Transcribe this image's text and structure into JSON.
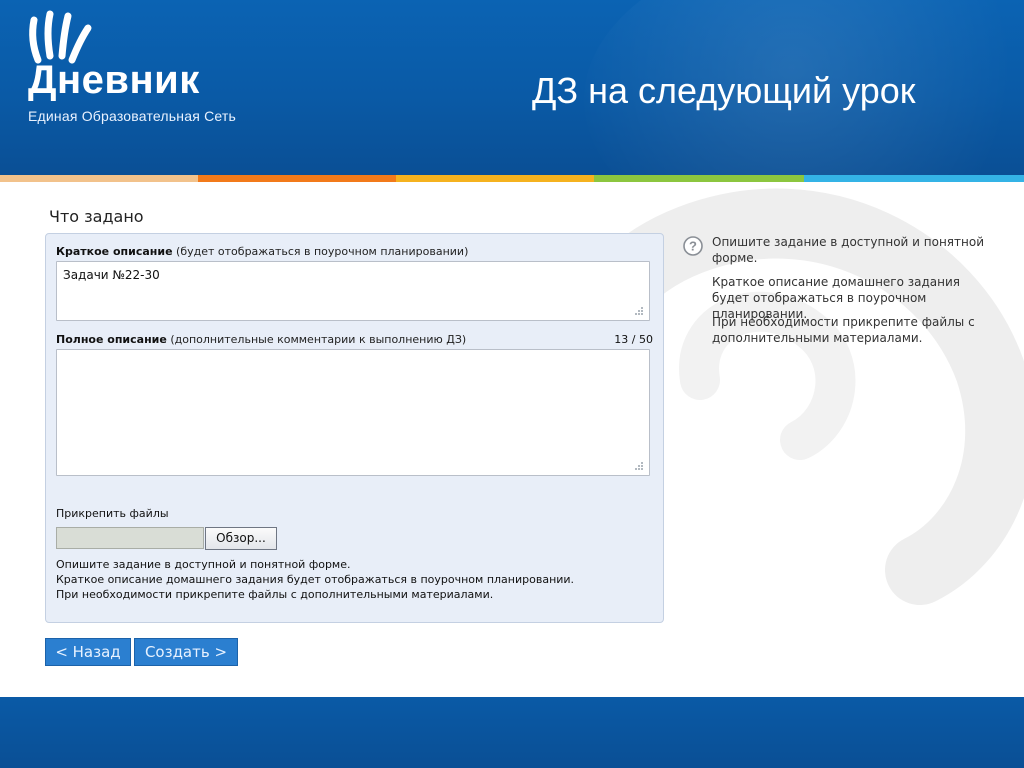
{
  "header": {
    "logo_word": "Дневник",
    "logo_subtitle": "Единая Образовательная Сеть",
    "slide_title": "ДЗ на следующий урок"
  },
  "section": {
    "title": "Что задано"
  },
  "form": {
    "short_label_bold": "Краткое описание",
    "short_label_note": " (будет отображаться в поурочном планировании)",
    "short_value": "Задачи №22-30",
    "full_label_bold": "Полное описание",
    "full_label_note": " (дополнительные комментарии к выполнению ДЗ)",
    "counter": "13 / 50",
    "full_value": "",
    "attach_label": "Прикрепить файлы",
    "browse_label": "Обзор...",
    "hints": [
      "Опишите задание в доступной и понятной форме.",
      "Краткое описание домашнего задания будет отображаться в поурочном планировании.",
      "При необходимости прикрепите файлы с дополнительными материалами."
    ]
  },
  "sidebar": {
    "icon": "question-icon",
    "items": [
      "Опишите задание в доступной и понятной форме.",
      "Краткое описание домашнего задания будет отображаться в поурочном планировании.",
      "При необходимости прикрепите файлы с дополнительными материалами."
    ]
  },
  "buttons": {
    "back": "< Назад",
    "create": "Создать >"
  },
  "colors": {
    "header": "#0a5aa6",
    "panel": "#e8eef8",
    "button": "#2b7fd0",
    "stripe": [
      "#f2c28b",
      "#f27a1a",
      "#f5b21f",
      "#8cc63f",
      "#34b3e6"
    ]
  }
}
